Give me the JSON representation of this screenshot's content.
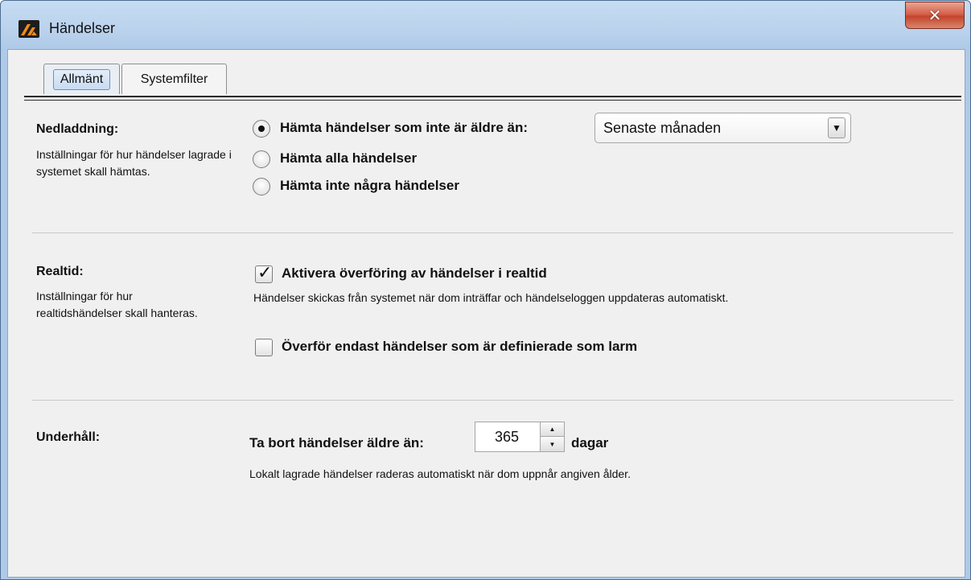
{
  "window": {
    "title": "Händelser",
    "close_glyph": "✕"
  },
  "tabs": [
    {
      "label": "Allmänt"
    },
    {
      "label": "Systemfilter"
    }
  ],
  "nedladdning": {
    "title": "Nedladdning:",
    "description": "Inställningar för hur händelser lagrade i systemet skall hämtas.",
    "options": [
      {
        "label": "Hämta händelser som inte är äldre än:",
        "checked": true
      },
      {
        "label": "Hämta alla händelser",
        "checked": false
      },
      {
        "label": "Hämta inte några händelser",
        "checked": false
      }
    ],
    "period_select": {
      "value": "Senaste månaden",
      "arrow": "▼"
    }
  },
  "realtid": {
    "title": "Realtid:",
    "description": "Inställningar för hur realtidshändelser skall hanteras.",
    "enable_label": "Aktivera överföring av händelser i realtid",
    "enable_checked": true,
    "enable_note": "Händelser skickas från systemet när dom inträffar och händelseloggen uppdateras automatiskt.",
    "alarms_only_label": "Överför endast händelser som är definierade som larm",
    "alarms_only_checked": false,
    "check_glyph": "✓"
  },
  "underhall": {
    "title": "Underhåll:",
    "delete_label": "Ta bort händelser äldre än:",
    "days_value": "365",
    "days_unit": "dagar",
    "note": "Lokalt lagrade händelser raderas automatiskt när dom uppnår angiven ålder.",
    "spin_up": "▲",
    "spin_down": "▼"
  },
  "colors": {
    "titlebar": "#b9d1ec",
    "client_background": "#f0f0f0",
    "close_button": "#c4442c",
    "app_icon_accent": "#f28c1c"
  }
}
